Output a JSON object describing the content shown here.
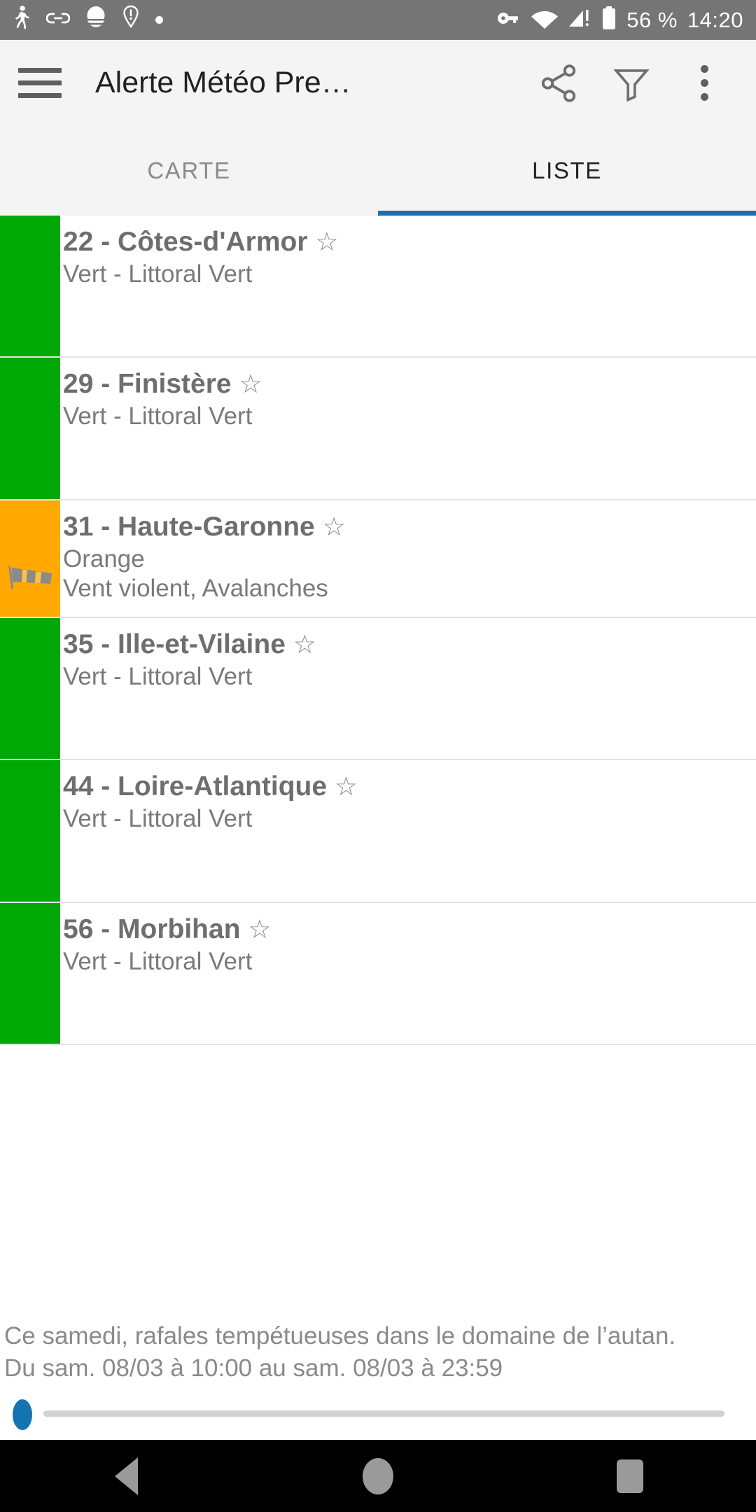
{
  "statusbar": {
    "icons_left": [
      "walking-person-icon",
      "link-icon",
      "cloud-icon",
      "location-alert-icon",
      "dot-icon"
    ],
    "icons_right": [
      "vpn-key-icon",
      "wifi-icon",
      "signal-no-sim-icon",
      "battery-icon"
    ],
    "battery": "56 %",
    "time": "14:20"
  },
  "appbar": {
    "menu_icon": "hamburger-menu-icon",
    "title": "Alerte Météo Pre…",
    "share_icon": "share-icon",
    "filter_icon": "filter-funnel-icon",
    "overflow_icon": "overflow-menu-icon"
  },
  "tabs": [
    {
      "label": "CARTE",
      "active": false
    },
    {
      "label": "LISTE",
      "active": true
    }
  ],
  "colors": {
    "green": "#00a806",
    "orange": "#ffa800",
    "accent": "#1c6fb0",
    "slider_thumb": "#1673b1"
  },
  "list": [
    {
      "title": "22 - Côtes-d'Armor",
      "star": "☆",
      "lines": [
        "Vert - Littoral Vert"
      ],
      "color": "#00a806",
      "level": "Vert",
      "icon": null
    },
    {
      "title": "29 - Finistère",
      "star": "☆",
      "lines": [
        "Vert - Littoral Vert"
      ],
      "color": "#00a806",
      "level": "Vert",
      "icon": null
    },
    {
      "title": "31 - Haute-Garonne",
      "star": "☆",
      "lines": [
        "Orange",
        "Vent violent, Avalanches"
      ],
      "color": "#ffa800",
      "level": "Orange",
      "icon": "windsock-icon"
    },
    {
      "title": "35 - Ille-et-Vilaine",
      "star": "☆",
      "lines": [
        "Vert - Littoral Vert"
      ],
      "color": "#00a806",
      "level": "Vert",
      "icon": null
    },
    {
      "title": "44 - Loire-Atlantique",
      "star": "☆",
      "lines": [
        "Vert - Littoral Vert"
      ],
      "color": "#00a806",
      "level": "Vert",
      "icon": null
    },
    {
      "title": "56 - Morbihan",
      "star": "☆",
      "lines": [
        "Vert - Littoral Vert"
      ],
      "color": "#00a806",
      "level": "Vert",
      "icon": null
    }
  ],
  "footer": {
    "line1": "Ce samedi, rafales tempétueuses dans le domaine de l’autan.",
    "line2": "Du sam. 08/03 à 10:00 au sam. 08/03 à 23:59"
  },
  "slider": {
    "value": 0
  },
  "navbar": {
    "back": "back-nav-icon",
    "home": "home-nav-icon",
    "recents": "recents-nav-icon"
  }
}
